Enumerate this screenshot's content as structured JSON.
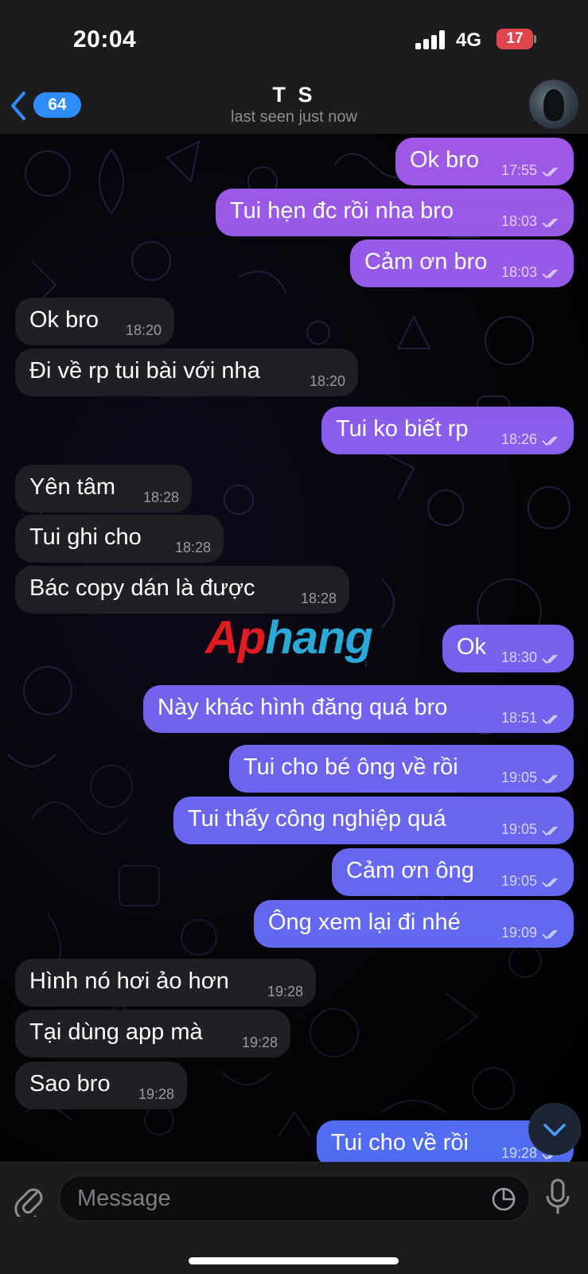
{
  "status_bar": {
    "time": "20:04",
    "network": "4G",
    "battery": "17"
  },
  "header": {
    "back_count": "64",
    "title": "T S",
    "subtitle": "last seen just now"
  },
  "messages": [
    {
      "dir": "out",
      "text": "Ok bro",
      "time": "17:55"
    },
    {
      "dir": "out",
      "text": "Tui hẹn đc rồi nha bro",
      "time": "18:03"
    },
    {
      "dir": "out",
      "text": "Cảm ơn bro",
      "time": "18:03"
    },
    {
      "dir": "in",
      "text": "Ok bro",
      "time": "18:20"
    },
    {
      "dir": "in",
      "text": "Đi về rp tui bài với nha",
      "time": "18:20"
    },
    {
      "dir": "out",
      "text": "Tui ko biết rp",
      "time": "18:26"
    },
    {
      "dir": "in",
      "text": "Yên tâm",
      "time": "18:28"
    },
    {
      "dir": "in",
      "text": "Tui ghi cho",
      "time": "18:28"
    },
    {
      "dir": "in",
      "text": "Bác copy dán là được",
      "time": "18:28"
    },
    {
      "dir": "out",
      "text": "Ok",
      "time": "18:30"
    },
    {
      "dir": "out",
      "text": "Này khác hình đăng quá bro",
      "time": "18:51"
    },
    {
      "dir": "out",
      "text": "Tui cho bé ông về rồi",
      "time": "19:05"
    },
    {
      "dir": "out",
      "text": "Tui thấy công nghiệp quá",
      "time": "19:05"
    },
    {
      "dir": "out",
      "text": "Cảm ơn ông",
      "time": "19:05"
    },
    {
      "dir": "out",
      "text": "Ông xem lại đi nhé",
      "time": "19:09"
    },
    {
      "dir": "in",
      "text": "Hình nó hơi ảo hơn",
      "time": "19:28"
    },
    {
      "dir": "in",
      "text": "Tại dùng app mà",
      "time": "19:28"
    },
    {
      "dir": "in",
      "text": "Sao bro",
      "time": "19:28"
    },
    {
      "dir": "out",
      "text": "Tui cho về rồi",
      "time": "19:28"
    }
  ],
  "watermark": {
    "part1": "Ap",
    "part2": "hang"
  },
  "input": {
    "placeholder": "Message"
  },
  "icons": {
    "back": "chevron-left-icon",
    "attach": "paperclip-icon",
    "sticker": "sticker-icon",
    "mic": "microphone-icon",
    "scroll": "chevron-down-icon",
    "read": "double-check-icon"
  },
  "colors": {
    "outgoing_top": "#a057e6",
    "outgoing_bottom": "#4f6cf2",
    "incoming": "#1f1f24",
    "accent": "#2f8cff"
  }
}
